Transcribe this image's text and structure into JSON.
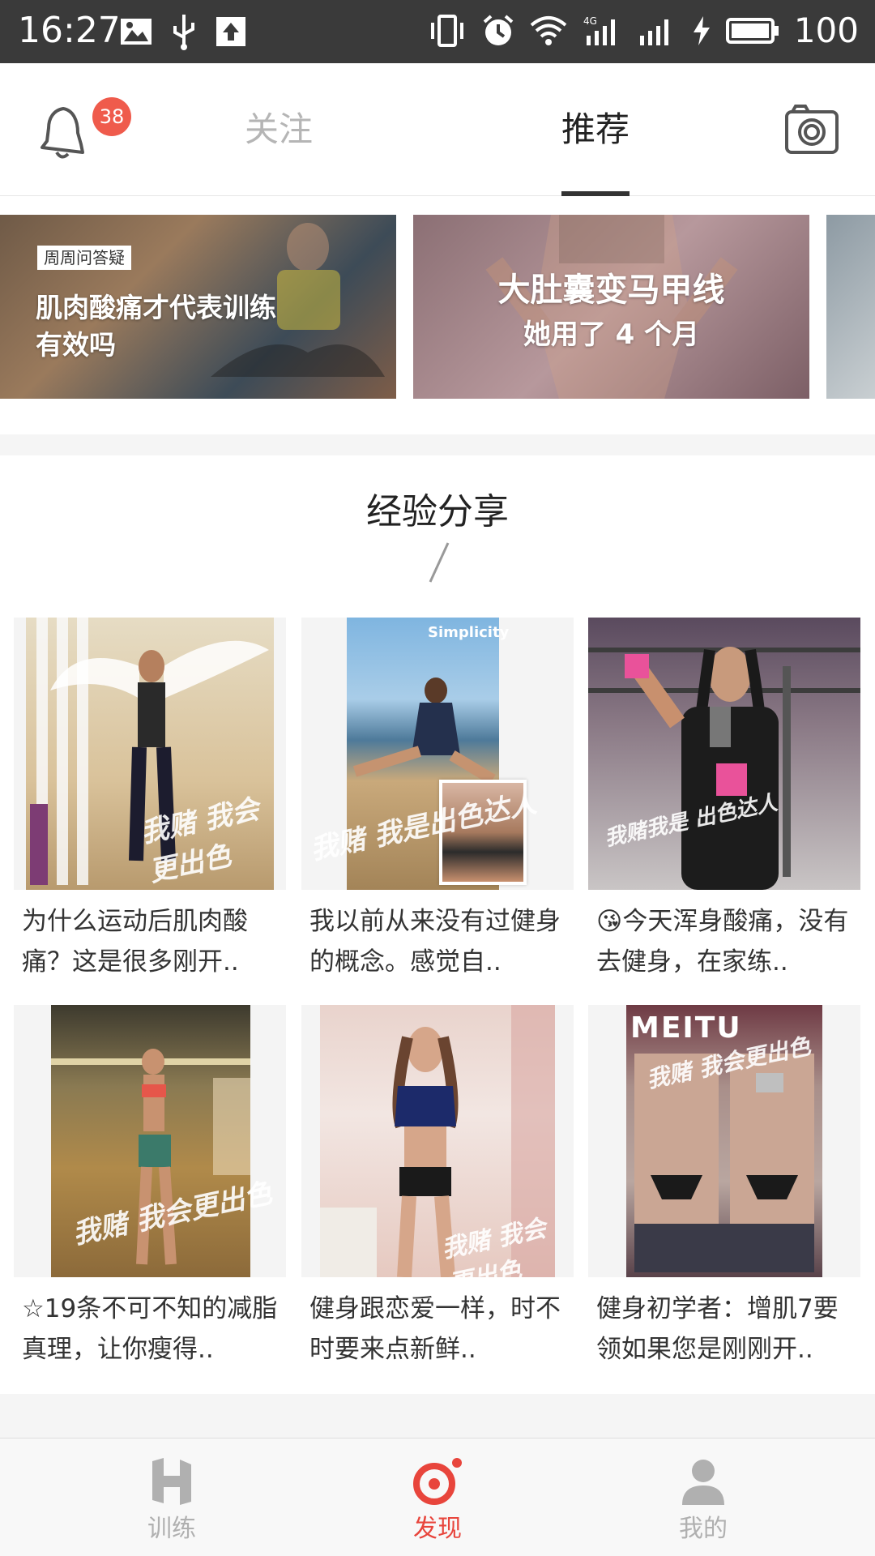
{
  "status_bar": {
    "time": "16:27",
    "network": "4G",
    "battery": "100"
  },
  "header": {
    "notification_count": "38",
    "tabs": [
      {
        "label": "关注",
        "active": false
      },
      {
        "label": "推荐",
        "active": true
      }
    ]
  },
  "banners": [
    {
      "tag": "周周问答疑",
      "title": "肌肉酸痛才代表训练有效吗"
    },
    {
      "line1": "大肚囊变马甲线",
      "line2": "她用了 4 个月"
    }
  ],
  "section": {
    "title": "经验分享",
    "cards": [
      {
        "text": "为什么运动后肌肉酸痛？这是很多刚开..",
        "watermark": "我赌 我会更出色"
      },
      {
        "text": "我以前从来没有过健身的概念。感觉自..",
        "watermark": "我赌 我是出色达人",
        "caption": "Simplicity"
      },
      {
        "text": "😘今天浑身酸痛，没有去健身，在家练..",
        "watermark": "我赌我是 出色达人"
      },
      {
        "text": "☆19条不可不知的减脂真理，让你瘦得..",
        "watermark": "我赌 我会更出色"
      },
      {
        "text": "健身跟恋爱一样，时不时要来点新鲜..",
        "watermark": "我赌 我会更出色"
      },
      {
        "text": "健身初学者：增肌7要领如果您是刚刚开..",
        "watermark": "我赌 我会更出色",
        "caption": "MEITU"
      }
    ]
  },
  "bottom_nav": [
    {
      "label": "训练",
      "icon": "h-logo-icon",
      "active": false
    },
    {
      "label": "发现",
      "icon": "discover-icon",
      "active": true
    },
    {
      "label": "我的",
      "icon": "profile-icon",
      "active": false
    }
  ],
  "colors": {
    "accent": "#e8453c",
    "badge": "#ef5b4c",
    "inactive": "#b5b5b5"
  }
}
